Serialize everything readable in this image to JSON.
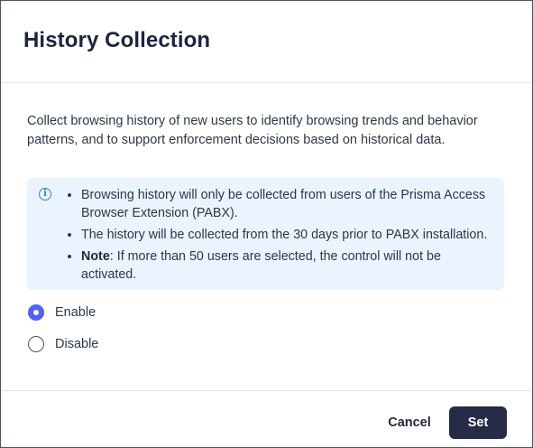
{
  "dialog": {
    "title": "History Collection",
    "description": "Collect browsing history of new users to identify browsing trends and behavior patterns, and to support enforcement decisions based on historical data.",
    "info": {
      "icon": "info-icon",
      "accent_color": "#3b82c4",
      "background_color": "#e9f4fe",
      "items": [
        {
          "prefix": "",
          "text": "Browsing history will only be collected from users of the Prisma Access Browser Extension (PABX)."
        },
        {
          "prefix": "",
          "text": "The history will be collected from the 30 days prior to PABX installation."
        },
        {
          "prefix": "Note",
          "text": ": If more than 50 users are selected, the control will not be activated."
        }
      ]
    },
    "options": [
      {
        "label": "Enable",
        "selected": true
      },
      {
        "label": "Disable",
        "selected": false
      }
    ],
    "footer": {
      "cancel_label": "Cancel",
      "set_label": "Set"
    },
    "colors": {
      "primary_button": "#262b47",
      "radio_selected": "#4f63f7",
      "title": "#1e2340"
    }
  }
}
